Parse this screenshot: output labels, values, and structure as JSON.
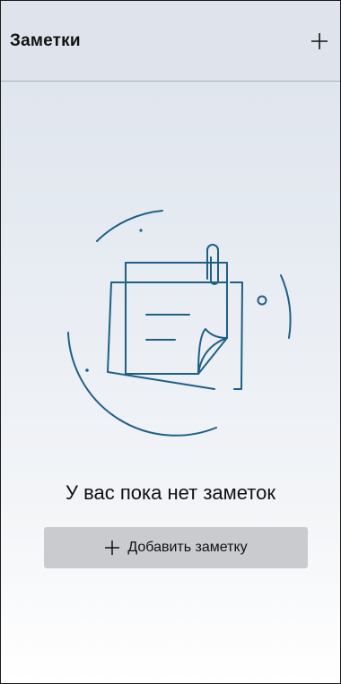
{
  "header": {
    "title": "Заметки",
    "add_icon": "plus-icon"
  },
  "empty_state": {
    "illustration": "notes-paperclip-illustration",
    "message": "У вас пока нет заметок"
  },
  "actions": {
    "add_note_label": "Добавить заметку",
    "add_note_icon": "plus-icon"
  },
  "colors": {
    "header_bg": "#dfe4ec",
    "illustration_stroke": "#1f5f86",
    "button_bg": "#c9cbcf",
    "text": "#111111"
  }
}
